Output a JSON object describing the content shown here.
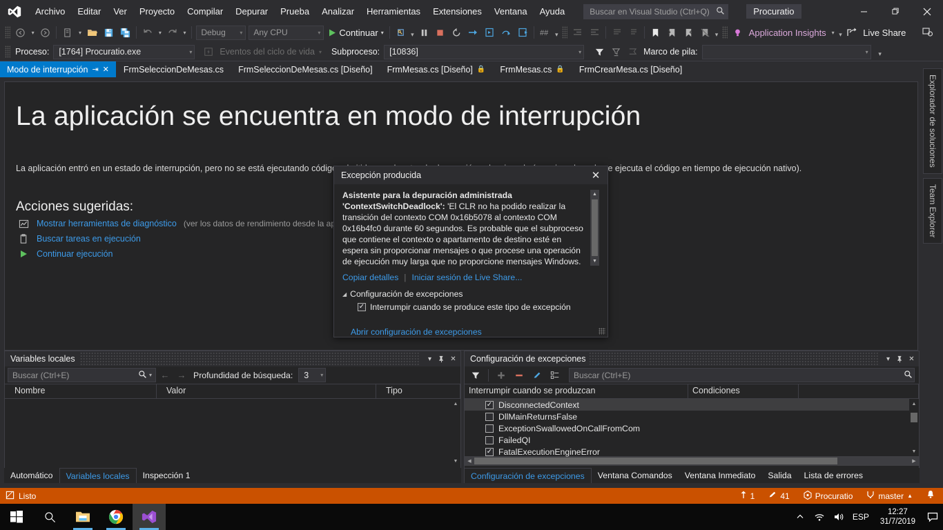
{
  "titlebar": {
    "logo_icon": "visual-studio-logo",
    "menu": [
      "Archivo",
      "Editar",
      "Ver",
      "Proyecto",
      "Compilar",
      "Depurar",
      "Prueba",
      "Analizar",
      "Herramientas",
      "Extensiones",
      "Ventana",
      "Ayuda"
    ],
    "search_placeholder": "Buscar en Visual Studio (Ctrl+Q)",
    "search_icon": "search-icon",
    "project_name": "Procuratio",
    "minimize_icon": "minimize-icon",
    "restore_icon": "restore-icon",
    "close_icon": "close-icon"
  },
  "toolbar": {
    "back_icon": "navigate-back-icon",
    "forward_icon": "navigate-forward-icon",
    "new_project_icon": "new-project-icon",
    "open_icon": "open-file-icon",
    "save_icon": "save-icon",
    "save_all_icon": "save-all-icon",
    "undo_icon": "undo-icon",
    "redo_icon": "redo-icon",
    "config_value": "Debug",
    "platform_value": "Any CPU",
    "continue_label": "Continuar",
    "continue_icon": "play-icon",
    "attach_icon": "attach-to-process-icon",
    "pause_icon": "pause-icon",
    "stop_icon": "stop-icon",
    "restart_icon": "restart-icon",
    "step_over_icon": "step-over-icon",
    "step_into_icon": "step-into-icon",
    "step_out_icon": "step-out-icon",
    "show_next_statement_icon": "show-next-statement-icon",
    "hex_icon": "hex-display-icon",
    "indent_icon": "indent-icon",
    "comment_icon": "comment-icon",
    "bookmark_icon": "bookmark-icon",
    "prev_bookmark_icon": "previous-bookmark-icon",
    "next_bookmark_icon": "next-bookmark-icon",
    "clear_bookmarks_icon": "clear-bookmarks-icon",
    "insights_label": "Application Insights",
    "insights_icon": "lightbulb-icon",
    "live_share_label": "Live Share",
    "live_share_icon": "live-share-icon",
    "feedback_icon": "send-feedback-icon"
  },
  "debugbar": {
    "process_label": "Proceso:",
    "process_value": "[1764] Procuratio.exe",
    "lifecycle_label": "Eventos del ciclo de vida",
    "lifecycle_icon": "lifecycle-events-icon",
    "thread_label": "Subproceso:",
    "thread_value": "[10836]",
    "filter_icon": "filter-icon",
    "filter_clear_icon": "clear-filter-icon",
    "flag_icon": "flagged-threads-icon",
    "stackframe_label": "Marco de pila:",
    "stackframe_value": ""
  },
  "tabs": [
    {
      "label": "Modo de interrupción",
      "active": true,
      "pinned": true,
      "closable": true,
      "locked": false
    },
    {
      "label": "FrmSeleccionDeMesas.cs",
      "active": false,
      "pinned": false,
      "closable": false,
      "locked": false
    },
    {
      "label": "FrmSeleccionDeMesas.cs [Diseño]",
      "active": false,
      "pinned": false,
      "closable": false,
      "locked": false
    },
    {
      "label": "FrmMesas.cs [Diseño]",
      "active": false,
      "pinned": false,
      "closable": false,
      "locked": true
    },
    {
      "label": "FrmMesas.cs",
      "active": false,
      "pinned": false,
      "closable": false,
      "locked": true
    },
    {
      "label": "FrmCrearMesa.cs [Diseño]",
      "active": false,
      "pinned": false,
      "closable": false,
      "locked": false
    }
  ],
  "editor": {
    "title": "La aplicación se encuentra en modo de interrupción",
    "description": "La aplicación entró en un estado de interrupción, pero no se está ejecutando código admitido por el motor de depuración seleccionado (por ejemplo, solo se ejecuta el código en tiempo de ejecución nativo).",
    "actions_title": "Acciones sugeridas:",
    "actions": [
      {
        "label": "Mostrar herramientas de diagnóstico",
        "note": "(ver los datos de rendimiento desde la aplicac",
        "icon": "diagnostics-icon"
      },
      {
        "label": "Buscar tareas en ejecución",
        "note": "",
        "icon": "tasks-icon"
      },
      {
        "label": "Continuar ejecución",
        "note": "",
        "icon": "play-icon"
      }
    ]
  },
  "rightdock": {
    "items": [
      "Explorador de soluciones",
      "Team Explorer"
    ]
  },
  "exception": {
    "title": "Excepción producida",
    "close_icon": "close-icon",
    "heading": "Asistente para la depuración administrada",
    "type": "'ContextSwitchDeadlock':",
    "message": "'El CLR no ha podido realizar la transición del contexto COM 0x16b5078 al contexto COM 0x16b4fc0 durante 60 segundos. Es probable que el subproceso que contiene el contexto o apartamento de destino esté en espera sin proporcionar mensajes o que procese una operación de ejecución muy larga que no proporcione mensajes Windows.",
    "copy_details": "Copiar detalles",
    "live_share": "Iniciar sesión de Live Share...",
    "settings_header": "Configuración de excepciones",
    "break_checkbox_label": "Interrumpir cuando se produce este tipo de excepción",
    "break_checkbox_checked": true,
    "open_settings_link": "Abrir configuración de excepciones"
  },
  "locals_panel": {
    "title": "Variables locales",
    "dropdown_icon": "chevron-down-icon",
    "pin_icon": "pin-icon",
    "close_icon": "close-icon",
    "search_placeholder": "Buscar (Ctrl+E)",
    "search_icon": "search-icon",
    "prev_icon": "arrow-left-icon",
    "next_icon": "arrow-right-icon",
    "depth_label": "Profundidad de búsqueda:",
    "depth_value": "3",
    "columns": [
      "Nombre",
      "Valor",
      "Tipo"
    ],
    "rows": [],
    "tabs": [
      {
        "label": "Automático",
        "active": false
      },
      {
        "label": "Variables locales",
        "active": true
      },
      {
        "label": "Inspección 1",
        "active": false
      }
    ]
  },
  "exceptions_panel": {
    "title": "Configuración de excepciones",
    "dropdown_icon": "chevron-down-icon",
    "pin_icon": "pin-icon",
    "close_icon": "close-icon",
    "filter_icon": "filter-icon",
    "add_icon": "add-icon",
    "remove_icon": "remove-icon",
    "edit_icon": "edit-icon",
    "expand_icon": "expand-all-icon",
    "search_placeholder": "Buscar (Ctrl+E)",
    "search_icon": "search-icon",
    "columns": [
      "Interrumpir cuando se produzcan",
      "Condiciones",
      ""
    ],
    "rows": [
      {
        "name": "DisconnectedContext",
        "checked": true,
        "selected": true,
        "conditions": ""
      },
      {
        "name": "DllMainReturnsFalse",
        "checked": false,
        "selected": false,
        "conditions": ""
      },
      {
        "name": "ExceptionSwallowedOnCallFromCom",
        "checked": false,
        "selected": false,
        "conditions": ""
      },
      {
        "name": "FailedQI",
        "checked": false,
        "selected": false,
        "conditions": ""
      },
      {
        "name": "FatalExecutionEngineError",
        "checked": true,
        "selected": false,
        "conditions": ""
      }
    ],
    "tabs": [
      {
        "label": "Configuración de excepciones",
        "active": true
      },
      {
        "label": "Ventana Comandos",
        "active": false
      },
      {
        "label": "Ventana Inmediato",
        "active": false
      },
      {
        "label": "Salida",
        "active": false
      },
      {
        "label": "Lista de errores",
        "active": false
      }
    ]
  },
  "statusbar": {
    "icon": "break-mode-icon",
    "text": "Listo",
    "up_count": "1",
    "up_icon": "arrow-up-icon",
    "pencil_count": "41",
    "pencil_icon": "pencil-icon",
    "repo_name": "Procuratio",
    "repo_icon": "repository-icon",
    "branch_name": "master",
    "branch_icon": "branch-icon",
    "branch_caret": "▲",
    "notify_icon": "notification-bell-icon",
    "background": "#ca5100"
  },
  "taskbar": {
    "start_icon": "windows-start-icon",
    "search_icon": "search-icon",
    "items": [
      {
        "name": "file-explorer-icon",
        "active": false,
        "running": true
      },
      {
        "name": "google-chrome-icon",
        "active": false,
        "running": true
      },
      {
        "name": "visual-studio-icon",
        "active": true,
        "running": true
      }
    ],
    "tray": {
      "chevron_icon": "show-hidden-icons-icon",
      "wifi_icon": "wifi-icon",
      "volume_icon": "volume-icon",
      "language": "ESP",
      "time": "12:27",
      "date": "31/7/2019",
      "action_center_icon": "action-center-icon"
    }
  }
}
